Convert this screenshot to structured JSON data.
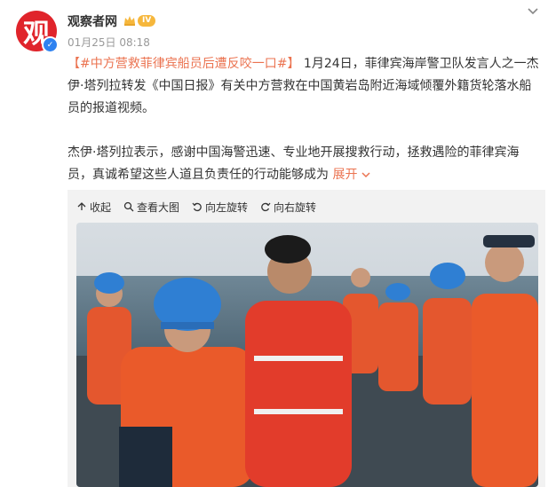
{
  "author": {
    "name": "观察者网",
    "avatar_glyph": "观",
    "level": "IV"
  },
  "post": {
    "time": "01月25日 08:18",
    "hashtag": "#中方营救菲律宾船员后遭反咬一口#",
    "para1": "1月24日，菲律宾海岸警卫队发言人之一杰伊·塔列拉转发《中国日报》有关中方营救在中国黄岩岛附近海域倾覆外籍货轮落水船员的报道视频。",
    "para2": "杰伊·塔列拉表示，感谢中国海警迅速、专业地开展搜救行动，拯救遇险的菲律宾海员，真诚希望这些人道且负责任的行动能够成为",
    "expand_label": "展开"
  },
  "media_toolbar": {
    "collapse": "收起",
    "view_large": "查看大图",
    "rotate_left": "向左旋转",
    "rotate_right": "向右旋转"
  },
  "colors": {
    "accent": "#eb7350",
    "brand_red": "#e0242b",
    "verified_blue": "#2e82f0"
  }
}
